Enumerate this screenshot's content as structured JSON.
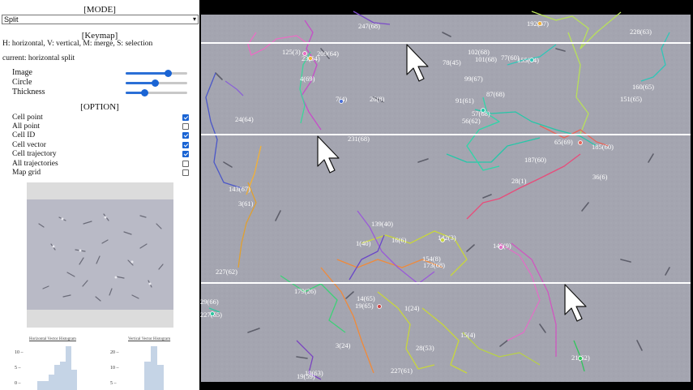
{
  "sidebar": {
    "mode_title": "[MODE]",
    "mode_value": "Split",
    "keymap_title": "[Keymap]",
    "keymap_text": "H: horizontal, V: vertical, M: merge, S: selection",
    "current_text": "current: horizontal split",
    "sliders": [
      {
        "label": "Image",
        "value": 0.68
      },
      {
        "label": "Circle",
        "value": 0.48
      },
      {
        "label": "Thickness",
        "value": 0.3
      }
    ],
    "option_title": "[OPTION]",
    "options": [
      {
        "label": "Cell point",
        "checked": true
      },
      {
        "label": "All point",
        "checked": false
      },
      {
        "label": "Cell ID",
        "checked": true
      },
      {
        "label": "Cell vector",
        "checked": true
      },
      {
        "label": "Cell trajectory",
        "checked": true
      },
      {
        "label": "All trajectories",
        "checked": false
      },
      {
        "label": "Map grid",
        "checked": false
      }
    ],
    "hist_h_title": "Horizontal Vector Histogram",
    "hist_v_title": "Vertical Vector Histogram",
    "hist_h_ticks": [
      "10 –",
      "5 –",
      "0 –"
    ],
    "hist_v_ticks": [
      "20 –",
      "10 –",
      "5 –"
    ]
  },
  "viewer": {
    "cell_labels": [
      "247(68)",
      "192(67)",
      "228(63)",
      "125(3)",
      "209(64)",
      "23(64)",
      "4(69)",
      "102(68)",
      "101(68)",
      "77(60)",
      "78(45)",
      "155(64)",
      "99(67)",
      "160(65)",
      "151(65)",
      "87(68)",
      "91(61)",
      "7(4)",
      "26(8)",
      "57(68)",
      "56(62)",
      "24(64)",
      "231(68)",
      "65(69)",
      "185(60)",
      "187(60)",
      "28(1)",
      "36(6)",
      "143(67)",
      "3(61)",
      "139(40)",
      "1(40)",
      "16(6)",
      "142(3)",
      "146(9)",
      "154(8)",
      "173(68)",
      "227(62)",
      "179(26)",
      "14(65)",
      "19(65)",
      "1(24)",
      "29(66)",
      "227(65)",
      "15(4)",
      "3(24)",
      "28(53)",
      "227(61)",
      "21(62)",
      "19(63)",
      "19(59)"
    ]
  }
}
